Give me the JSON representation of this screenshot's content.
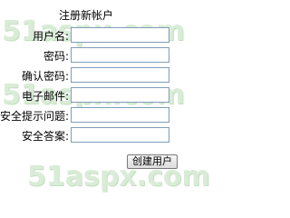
{
  "watermark": "51aspx.com",
  "form": {
    "title": "注册新帐户",
    "fields": [
      {
        "label": "用户名:",
        "value": ""
      },
      {
        "label": "密码:",
        "value": ""
      },
      {
        "label": "确认密码:",
        "value": ""
      },
      {
        "label": "电子邮件:",
        "value": ""
      },
      {
        "label": "安全提示问题:",
        "value": ""
      },
      {
        "label": "安全答案:",
        "value": ""
      }
    ],
    "submit_label": "创建用户"
  }
}
